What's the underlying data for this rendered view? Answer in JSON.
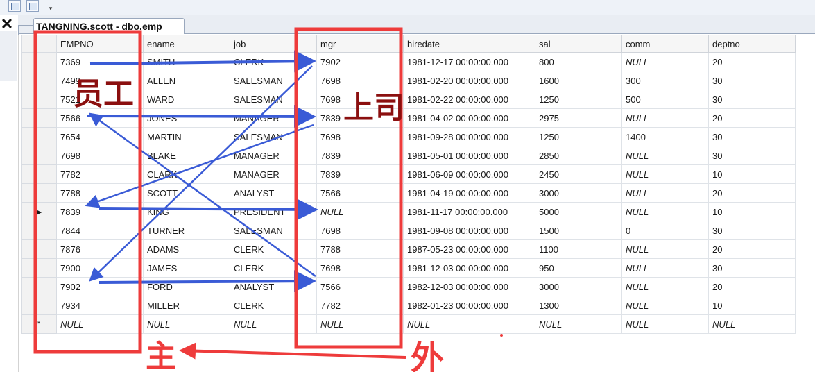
{
  "tab": {
    "title": "TANGNING.scott - dbo.emp"
  },
  "grid": {
    "columns": [
      "EMPNO",
      "ename",
      "job",
      "mgr",
      "hiredate",
      "sal",
      "comm",
      "deptno"
    ],
    "rows": [
      [
        "7369",
        "SMITH",
        "CLERK",
        "7902",
        "1981-12-17 00:00:00.000",
        "800",
        "NULL",
        "20"
      ],
      [
        "7499",
        "ALLEN",
        "SALESMAN",
        "7698",
        "1981-02-20 00:00:00.000",
        "1600",
        "300",
        "30"
      ],
      [
        "7521",
        "WARD",
        "SALESMAN",
        "7698",
        "1981-02-22 00:00:00.000",
        "1250",
        "500",
        "30"
      ],
      [
        "7566",
        "JONES",
        "MANAGER",
        "7839",
        "1981-04-02 00:00:00.000",
        "2975",
        "NULL",
        "20"
      ],
      [
        "7654",
        "MARTIN",
        "SALESMAN",
        "7698",
        "1981-09-28 00:00:00.000",
        "1250",
        "1400",
        "30"
      ],
      [
        "7698",
        "BLAKE",
        "MANAGER",
        "7839",
        "1981-05-01 00:00:00.000",
        "2850",
        "NULL",
        "30"
      ],
      [
        "7782",
        "CLARK",
        "MANAGER",
        "7839",
        "1981-06-09 00:00:00.000",
        "2450",
        "NULL",
        "10"
      ],
      [
        "7788",
        "SCOTT",
        "ANALYST",
        "7566",
        "1981-04-19 00:00:00.000",
        "3000",
        "NULL",
        "20"
      ],
      [
        "7839",
        "KING",
        "PRESIDENT",
        "NULL",
        "1981-11-17 00:00:00.000",
        "5000",
        "NULL",
        "10"
      ],
      [
        "7844",
        "TURNER",
        "SALESMAN",
        "7698",
        "1981-09-08 00:00:00.000",
        "1500",
        "0",
        "30"
      ],
      [
        "7876",
        "ADAMS",
        "CLERK",
        "7788",
        "1987-05-23 00:00:00.000",
        "1100",
        "NULL",
        "20"
      ],
      [
        "7900",
        "JAMES",
        "CLERK",
        "7698",
        "1981-12-03 00:00:00.000",
        "950",
        "NULL",
        "30"
      ],
      [
        "7902",
        "FORD",
        "ANALYST",
        "7566",
        "1982-12-03 00:00:00.000",
        "3000",
        "NULL",
        "20"
      ],
      [
        "7934",
        "MILLER",
        "CLERK",
        "7782",
        "1982-01-23 00:00:00.000",
        "1300",
        "NULL",
        "10"
      ]
    ],
    "new_row": [
      "NULL",
      "NULL",
      "NULL",
      "NULL",
      "NULL",
      "NULL",
      "NULL",
      "NULL"
    ],
    "current_row_index": 8,
    "current_row_marker": "▶",
    "new_row_marker": "*"
  },
  "annotations": {
    "label_employee": "员工",
    "label_superior": "上司",
    "label_primary": "主",
    "label_foreign": "外",
    "red_color": "#ee3b3b",
    "dark_red_color": "#8b0f0f",
    "blue_color": "#3a5bd6"
  },
  "icons": {
    "toolbar": [
      "grid-icon",
      "results-to-icon"
    ],
    "close": "close-icon"
  }
}
